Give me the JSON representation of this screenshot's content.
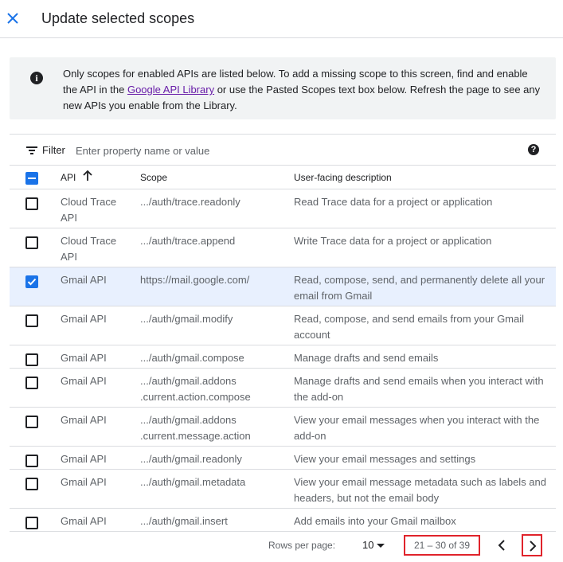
{
  "header": {
    "title": "Update selected scopes",
    "close_icon": "close-icon"
  },
  "info": {
    "icon": "info-icon",
    "text_before": "Only scopes for enabled APIs are listed below. To add a missing scope to this screen, find and enable the API in the ",
    "link_text": "Google API Library",
    "text_after": " or use the Pasted Scopes text box below. Refresh the page to see any new APIs you enable from the Library."
  },
  "filter": {
    "label": "Filter",
    "placeholder": "Enter property name or value",
    "value": "",
    "help_icon": "help-icon"
  },
  "table": {
    "columns": {
      "api": "API",
      "scope": "Scope",
      "description": "User-facing description"
    },
    "header_checkbox_state": "indeterminate",
    "sort": {
      "column": "API",
      "direction": "ascending"
    },
    "rows": [
      {
        "api": "Cloud Trace API",
        "scope": ".../auth/trace.readonly",
        "description": "Read Trace data for a project or application",
        "checked": false
      },
      {
        "api": "Cloud Trace API",
        "scope": ".../auth/trace.append",
        "description": "Write Trace data for a project or application",
        "checked": false
      },
      {
        "api": "Gmail API",
        "scope": "https://mail.google.com/",
        "description": "Read, compose, send, and permanently delete all your email from Gmail",
        "checked": true
      },
      {
        "api": "Gmail API",
        "scope": ".../auth/gmail.modify",
        "description": "Read, compose, and send emails from your Gmail account",
        "checked": false
      },
      {
        "api": "Gmail API",
        "scope": ".../auth/gmail.compose",
        "description": "Manage drafts and send emails",
        "checked": false
      },
      {
        "api": "Gmail API",
        "scope": ".../auth/gmail.addons .current.action.compose",
        "description": "Manage drafts and send emails when you interact with the add-on",
        "checked": false
      },
      {
        "api": "Gmail API",
        "scope": ".../auth/gmail.addons .current.message.action",
        "description": "View your email messages when you interact with the add-on",
        "checked": false
      },
      {
        "api": "Gmail API",
        "scope": ".../auth/gmail.readonly",
        "description": "View your email messages and settings",
        "checked": false
      },
      {
        "api": "Gmail API",
        "scope": ".../auth/gmail.metadata",
        "description": "View your email message metadata such as labels and headers, but not the email body",
        "checked": false
      },
      {
        "api": "Gmail API",
        "scope": ".../auth/gmail.insert",
        "description": "Add emails into your Gmail mailbox",
        "checked": false
      }
    ]
  },
  "pagination": {
    "rows_per_page_label": "Rows per page:",
    "rows_per_page": "10",
    "range": "21 – 30 of 39",
    "prev_icon": "chevron-left-icon",
    "next_icon": "chevron-right-icon"
  },
  "colors": {
    "accent": "#1a73e8",
    "selected_row": "#e8f0fe",
    "highlight_box": "#e0232b",
    "info_bg": "#f1f3f4"
  }
}
